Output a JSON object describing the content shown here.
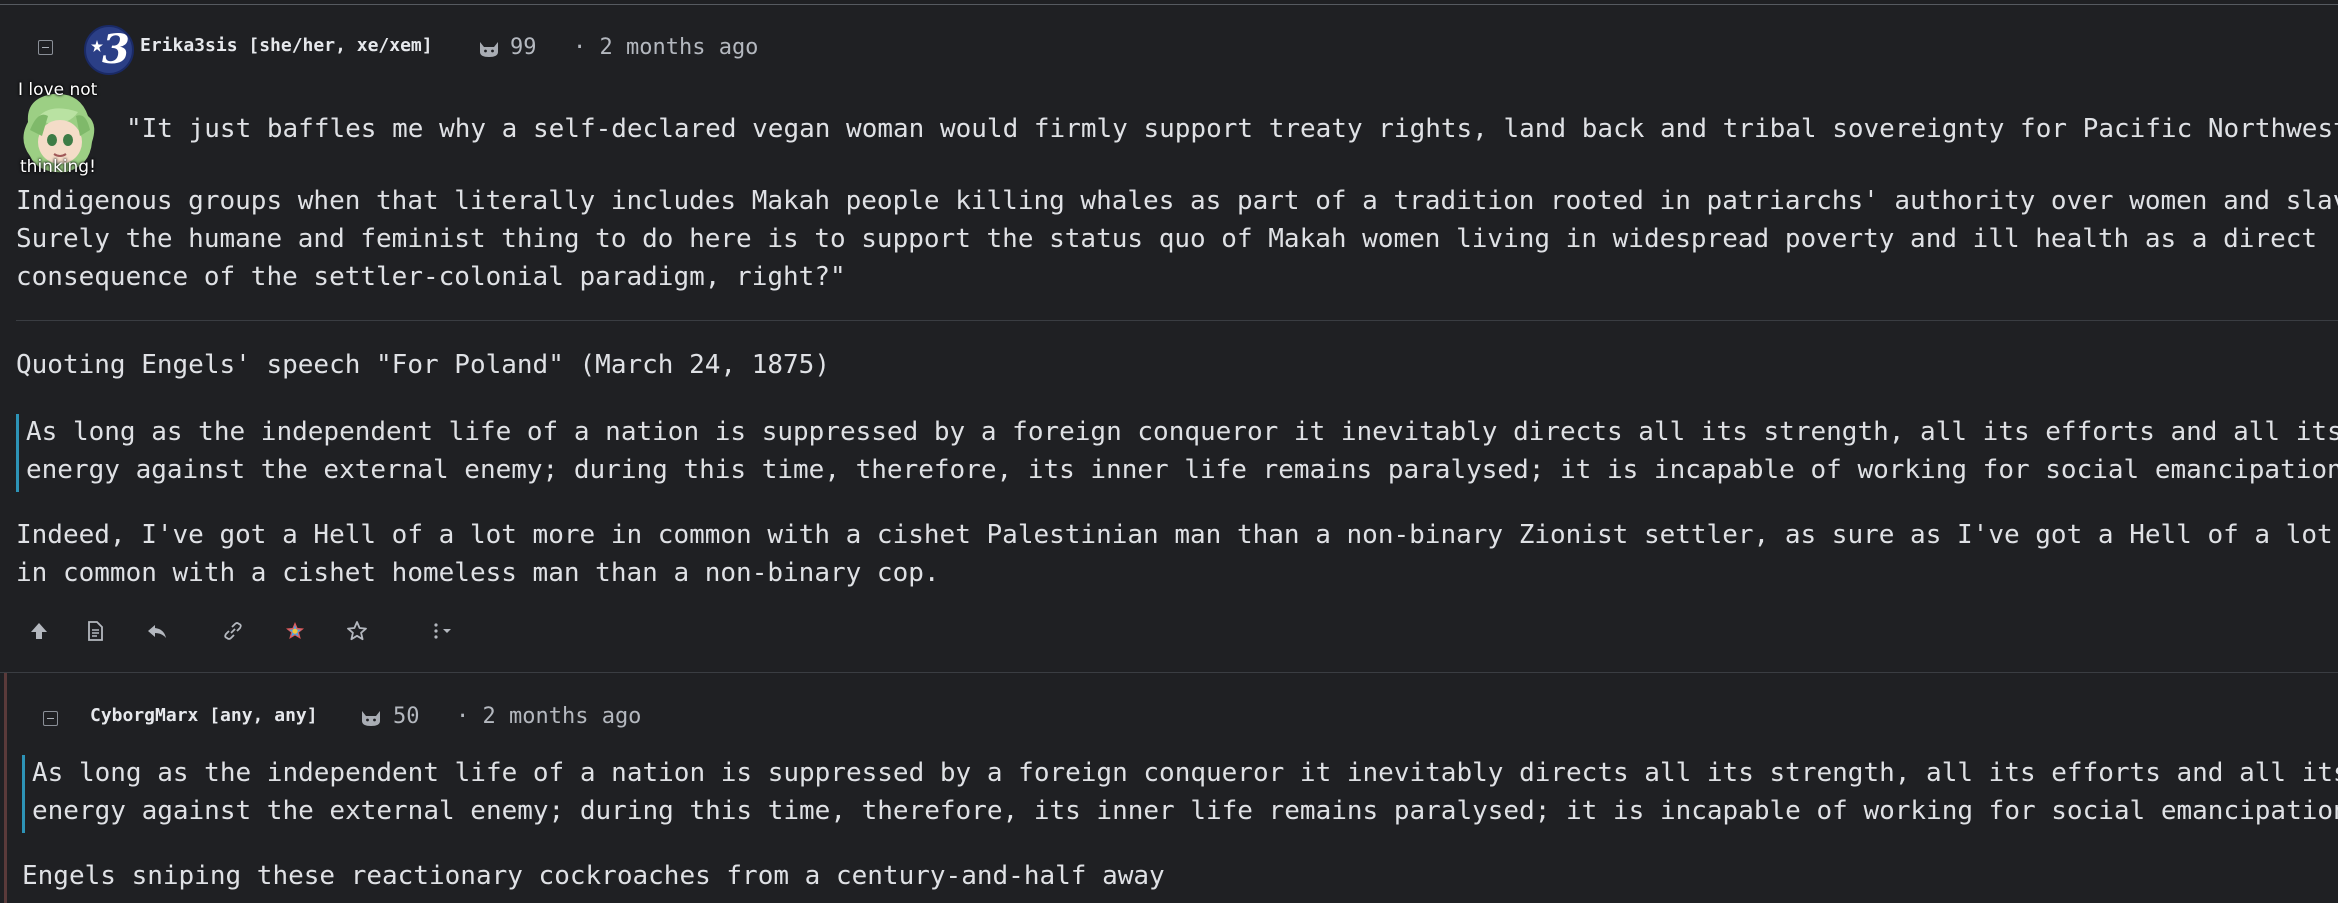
{
  "comment1": {
    "username": "Erika3sis [she/her, xe/xem]",
    "score": "99",
    "time": "· 2 months ago",
    "emote_caption_top": "I love not",
    "emote_caption_bottom": "thinking!",
    "line1": "\"It just baffles me why a self-declared vegan woman would firmly support treaty rights, land back and tribal sovereignty for Pacific Northwest",
    "line2": "Indigenous groups when that literally includes Makah people killing whales as part of a tradition rooted in patriarchs' authority over women and slaves.",
    "line3": "Surely the humane and feminist thing to do here is to support the status quo of Makah women living in widespread poverty and ill health as a direct",
    "line4": "consequence of the settler-colonial paradigm, right?\"",
    "quote_intro": "Quoting Engels' speech \"For Poland\" (March 24, 1875)",
    "quote_line1": "As long as the independent life of a nation is suppressed by a foreign conqueror it inevitably directs all its strength, all its efforts and all its",
    "quote_line2": "energy against the external enemy; during this time, therefore, its inner life remains paralysed; it is incapable of working for social emancipation.",
    "closing_line1": "Indeed, I've got a Hell of a lot more in common with a cishet Palestinian man than a non-binary Zionist settler, as sure as I've got a Hell of a lot more",
    "closing_line2": "in common with a cishet homeless man than a non-binary cop.",
    "actions": [
      "upvote-icon",
      "source-icon",
      "reply-icon",
      "link-icon",
      "award-icon",
      "save-icon",
      "more-icon"
    ]
  },
  "comment2": {
    "username": "CyborgMarx [any, any]",
    "score": "50",
    "time": "· 2 months ago",
    "quote_line1": "As long as the independent life of a nation is suppressed by a foreign conqueror it inevitably directs all its strength, all its efforts and all its",
    "quote_line2": "energy against the external enemy; during this time, therefore, its inner life remains paralysed; it is incapable of working for social emancipation.",
    "body": "Engels sniping these reactionary cockroaches from a century-and-half away"
  },
  "colors": {
    "background": "#1f2023",
    "text": "#dfe1e5",
    "muted": "#b4b8bf",
    "quote_bar": "#2d93b6",
    "divider": "#3a3d42"
  }
}
